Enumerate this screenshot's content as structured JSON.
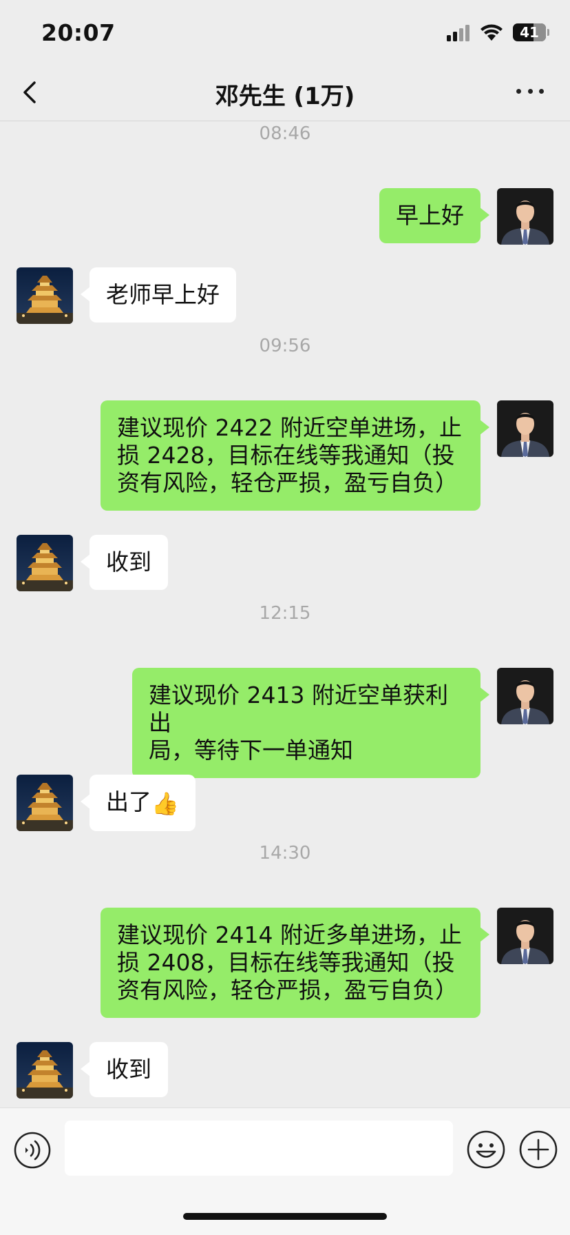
{
  "status_bar": {
    "time": "20:07",
    "battery": "41"
  },
  "header": {
    "title": "邓先生 (1万)"
  },
  "messages": [
    {
      "type": "timestamp",
      "text": "08:46"
    },
    {
      "type": "sent",
      "text": "早上好"
    },
    {
      "type": "received",
      "text": "老师早上好"
    },
    {
      "type": "timestamp",
      "text": "09:56"
    },
    {
      "type": "sent",
      "lines": [
        "建议现价 2422 附近空单进场，止",
        "损 2428，目标在线等我通知（投",
        "资有风险，轻仓严损，盈亏自负）"
      ]
    },
    {
      "type": "received",
      "text": "收到"
    },
    {
      "type": "timestamp",
      "text": "12:15"
    },
    {
      "type": "sent",
      "lines": [
        "建议现价 2413 附近空单获利出",
        "局，等待下一单通知"
      ]
    },
    {
      "type": "received",
      "text": "出了",
      "emoji": "👍"
    },
    {
      "type": "timestamp",
      "text": "14:30"
    },
    {
      "type": "sent",
      "lines": [
        "建议现价 2414 附近多单进场，止",
        "损 2408，目标在线等我通知（投",
        "资有风险，轻仓严损，盈亏自负）"
      ]
    },
    {
      "type": "received",
      "text": "收到"
    }
  ],
  "input_bar": {
    "text_value": ""
  },
  "colors": {
    "sent_bubble": "#95ec69",
    "received_bubble": "#ffffff",
    "background": "#ededed"
  },
  "icons": [
    "back-chevron-icon",
    "more-dots-icon",
    "voice-icon",
    "emoji-icon",
    "plus-icon",
    "thumbs-up-icon"
  ]
}
